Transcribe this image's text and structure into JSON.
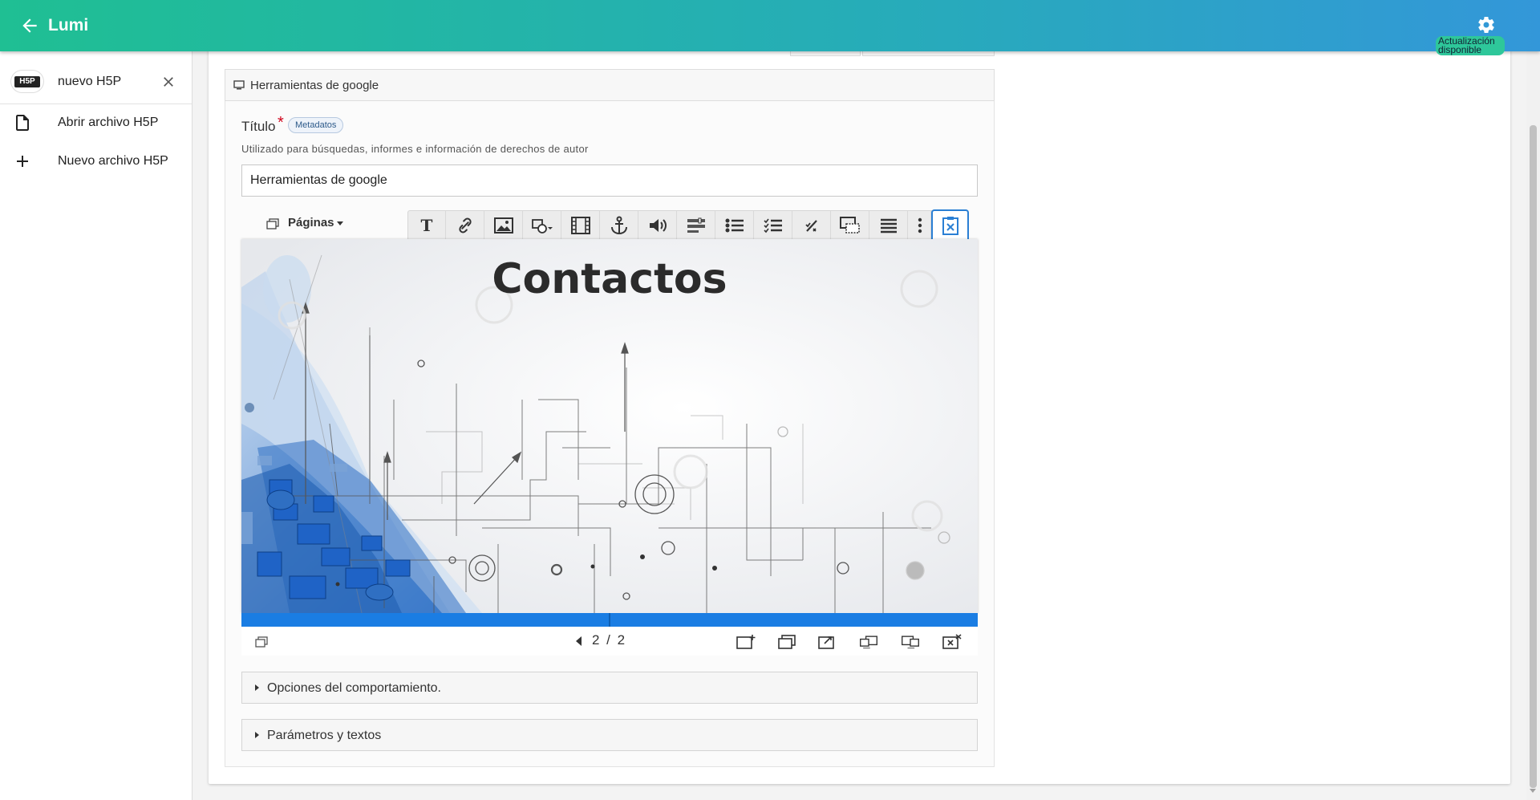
{
  "app": {
    "title": "Lumi",
    "update_label": "Actualización disponible"
  },
  "sidebar": {
    "file": {
      "badge": "H5P",
      "name": "nuevo H5P"
    },
    "items": [
      {
        "label": "Abrir archivo H5P",
        "icon": "file-icon"
      },
      {
        "label": "Nuevo archivo H5P",
        "icon": "plus-icon"
      }
    ]
  },
  "editor": {
    "section_header": "Herramientas de google",
    "title_label": "Título",
    "required_mark": "*",
    "metadata_button": "Metadatos",
    "title_description": "Utilizado para búsquedas, informes e información de derechos de autor",
    "title_value": "Herramientas de google",
    "pages_dropdown": "Páginas",
    "toolbar_icons": [
      "text-icon",
      "link-icon",
      "image-icon",
      "shapes-icon",
      "video-icon",
      "anchor-icon",
      "audio-icon",
      "slider-icon",
      "list-icon",
      "checklist-icon",
      "percent-icon",
      "dialog-icon",
      "summary-icon",
      "more-icon",
      "paste-icon"
    ],
    "slide_title": "Contactos",
    "slide_counter": "2 / 2",
    "accordions": [
      {
        "label": "Opciones del comportamiento."
      },
      {
        "label": "Parámetros y textos"
      }
    ]
  },
  "colors": {
    "header_start": "#1fbf93",
    "header_end": "#3397d9",
    "progress": "#1a7de3",
    "required": "#d0021b"
  }
}
